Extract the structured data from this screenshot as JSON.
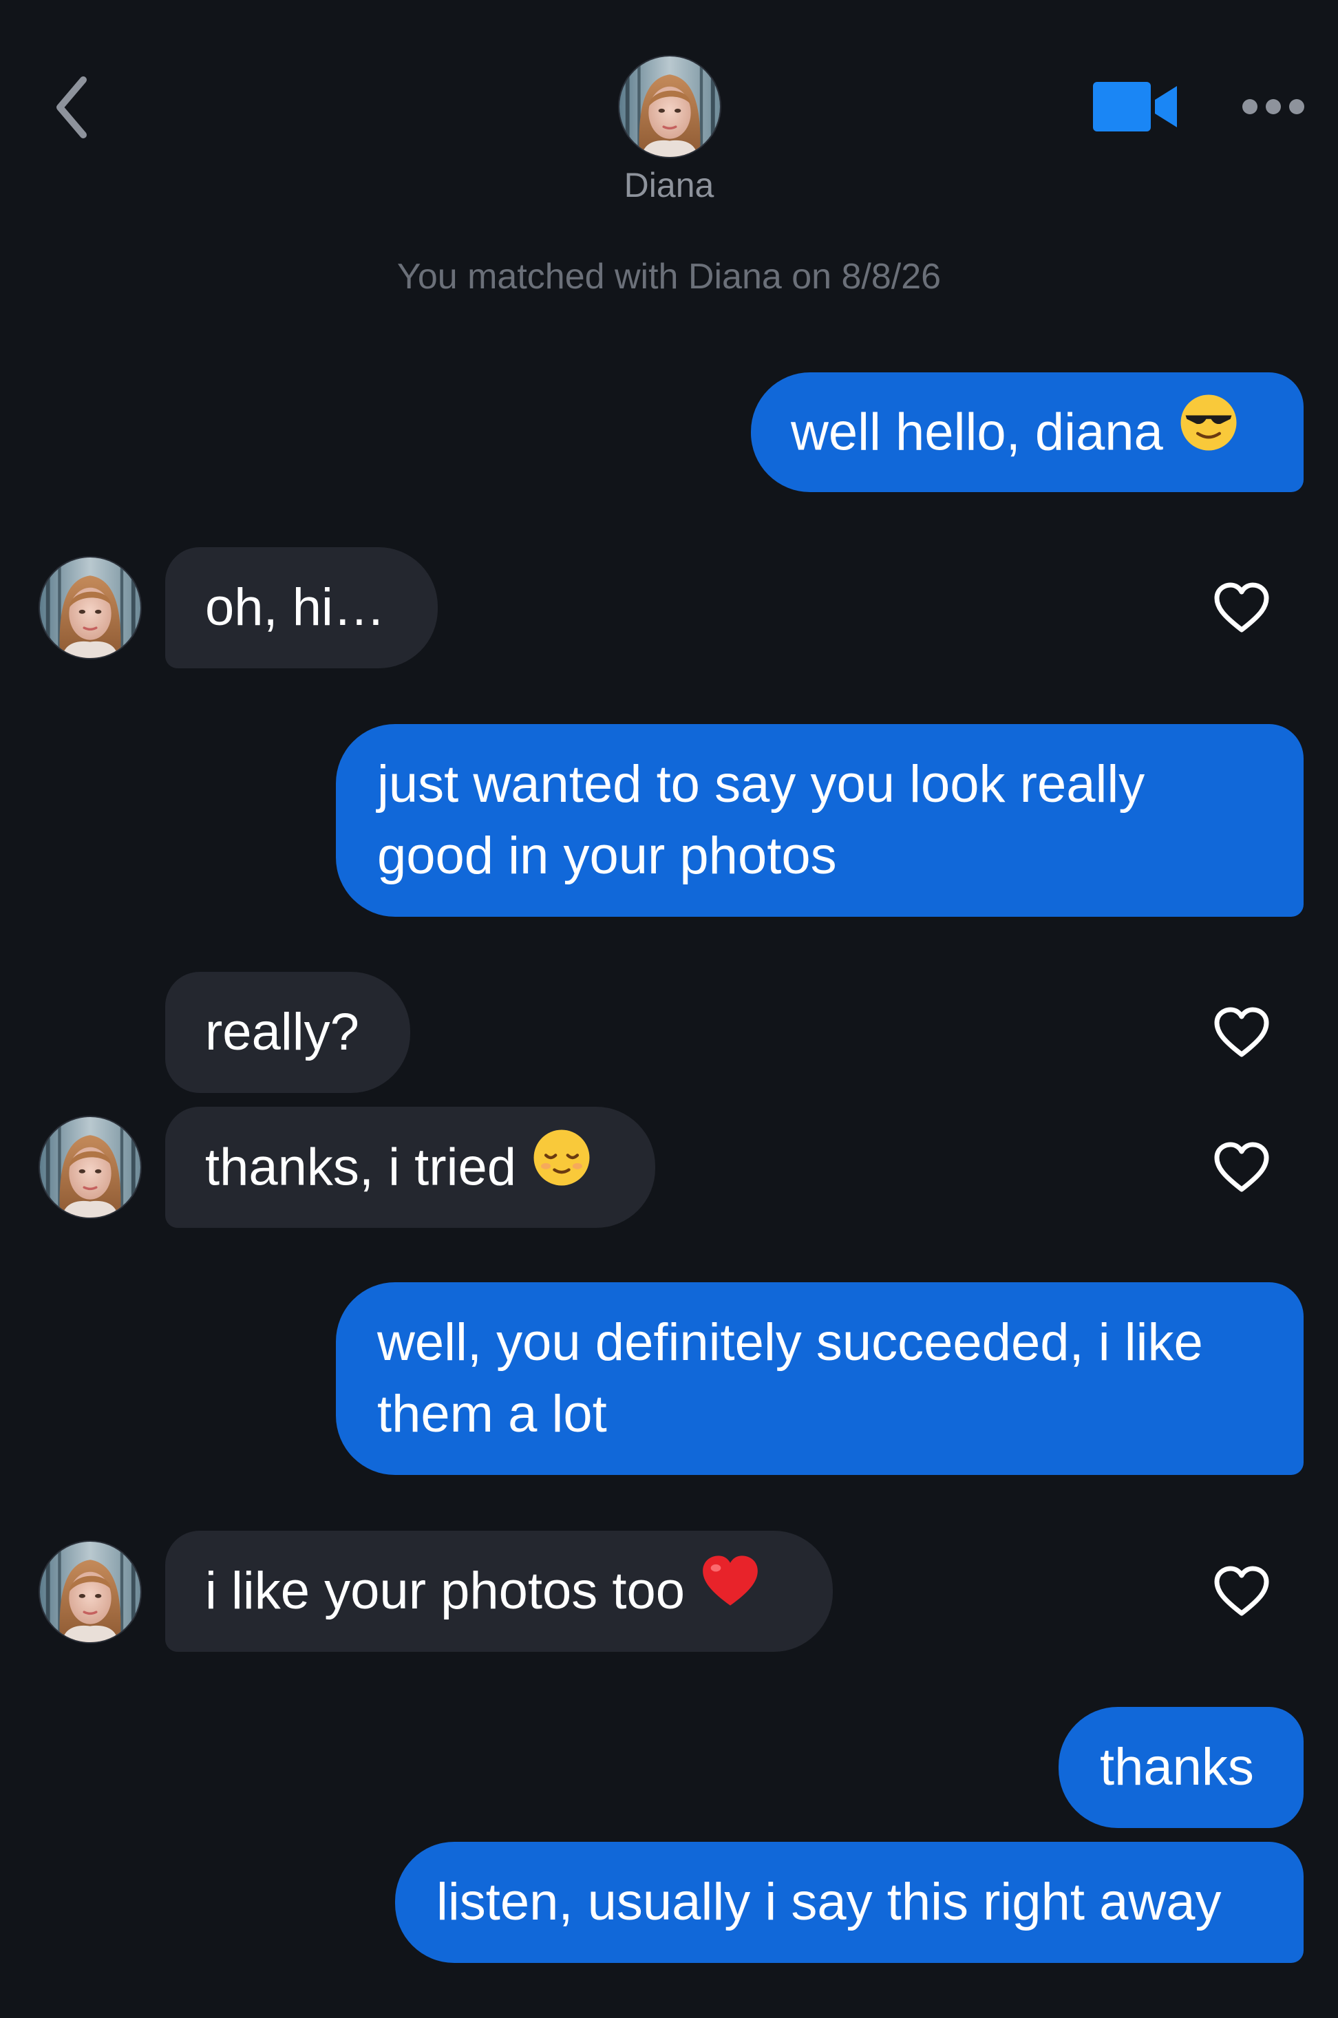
{
  "header": {
    "contact_name": "Diana",
    "icons": {
      "back": "chevron-left-icon",
      "video": "video-camera-icon",
      "more": "more-dots-icon"
    }
  },
  "match_note": "You matched with Diana on 8/8/26",
  "colors": {
    "background": "#111419",
    "sent_bubble": "#1168d9",
    "received_bubble": "#24272f",
    "accent": "#1a86f5"
  },
  "messages": [
    {
      "from": "me",
      "text": "well hello, diana",
      "emoji": "smiling-face-with-sunglasses"
    },
    {
      "from": "them",
      "text": "oh, hi…"
    },
    {
      "from": "me",
      "text": "just wanted to say you look really good in your photos"
    },
    {
      "from": "them",
      "text": "really?"
    },
    {
      "from": "them",
      "text": "thanks, i tried",
      "emoji": "relieved-face"
    },
    {
      "from": "me",
      "text": "well, you definitely succeeded, i like them a lot"
    },
    {
      "from": "them",
      "text": "i like your photos too",
      "emoji": "red-heart"
    },
    {
      "from": "me",
      "text": "thanks"
    },
    {
      "from": "me",
      "text": "listen, usually i say this right away"
    }
  ]
}
